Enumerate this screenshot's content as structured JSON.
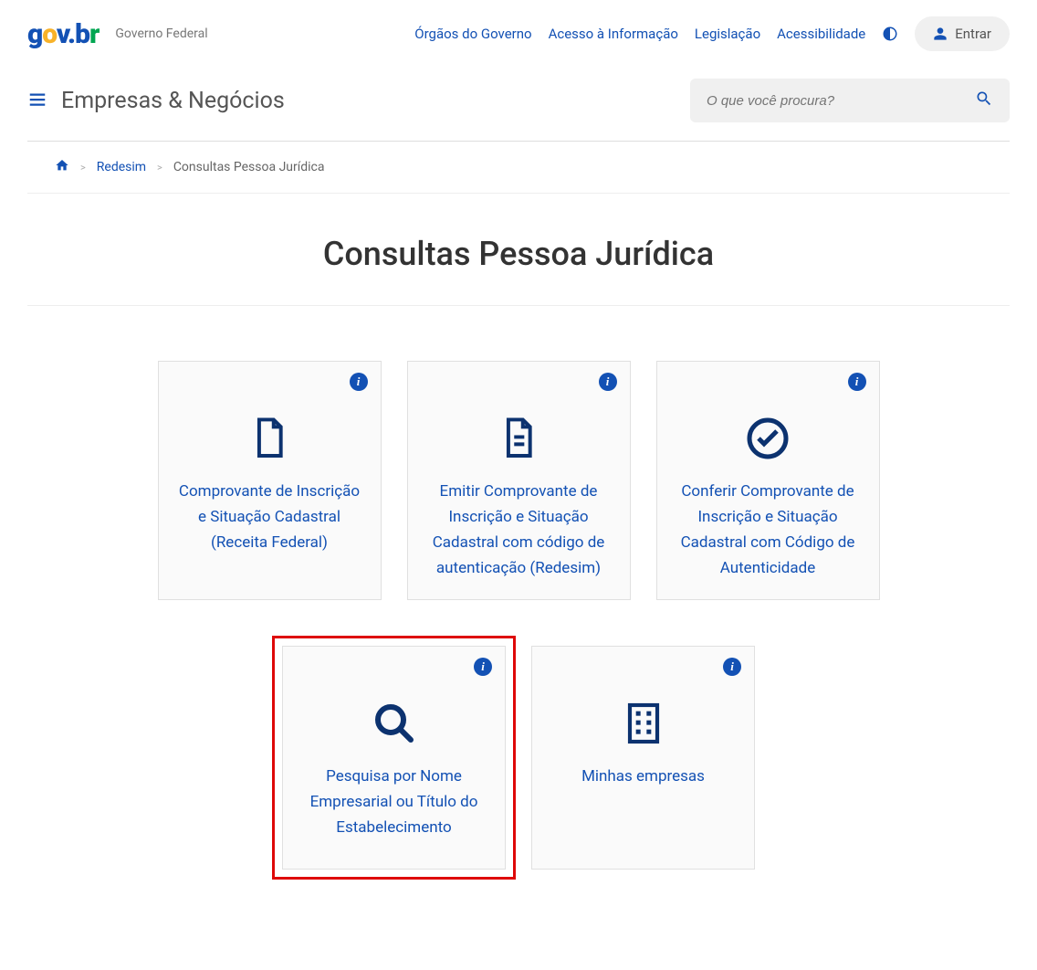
{
  "logo": {
    "g": "g",
    "o": "o",
    "v": "v",
    "dot": ".",
    "b": "b",
    "r": "r"
  },
  "subtitle": "Governo Federal",
  "topLinks": {
    "orgaos": "Órgãos do Governo",
    "acesso": "Acesso à Informação",
    "legislacao": "Legislação",
    "acessibilidade": "Acessibilidade"
  },
  "login": "Entrar",
  "portalTitle": "Empresas & Negócios",
  "search": {
    "placeholder": "O que você procura?"
  },
  "breadcrumb": {
    "redesim": "Redesim",
    "current": "Consultas Pessoa Jurídica"
  },
  "pageTitle": "Consultas Pessoa Jurídica",
  "tiles": {
    "t1": "Comprovante de Inscrição e Situação Cadastral (Receita Federal)",
    "t2": "Emitir Comprovante de Inscrição e Situação Cadastral com código de autenticação (Redesim)",
    "t3": "Conferir Comprovante de Inscrição e Situação Cadastral com Código de Autenticidade",
    "t4": "Pesquisa por Nome Empresarial ou Título do Estabelecimento",
    "t5": "Minhas empresas"
  }
}
